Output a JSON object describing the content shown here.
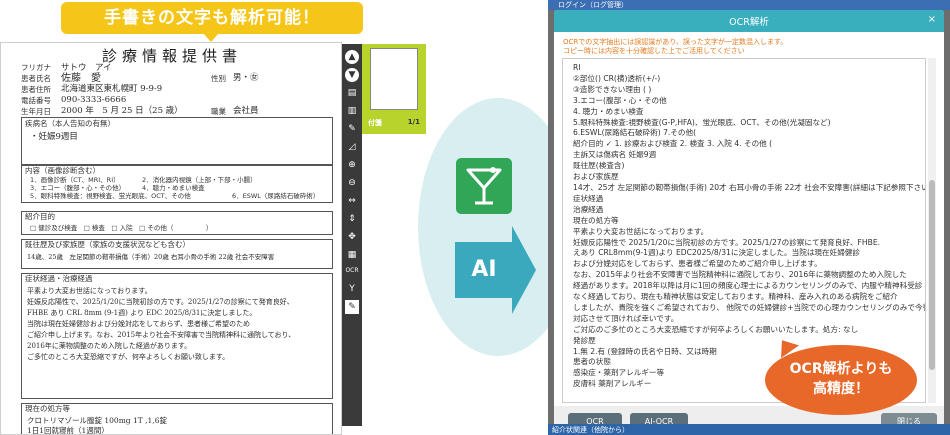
{
  "banners": {
    "left": "手書きの文字も解析可能！",
    "right_line1": "OCR解析よりも",
    "right_line2": "高精度！"
  },
  "form": {
    "title": "診療情報提供書",
    "furigana_label": "フリガナ",
    "furigana_value": "サトウ　アイ",
    "patient_name_label": "患者氏名",
    "patient_name_value": "佐藤　愛",
    "sex_label": "性別",
    "sex_value": "男・㊛",
    "address_label": "患者住所",
    "address_value": "北海道東区東札幌町 9-9-9",
    "phone_label": "電話番号",
    "phone_value": "090-3333-6666",
    "dob_label": "生年月日",
    "dob_value": "2000 年　5 月 25 日（25 歳）",
    "occupation_label": "職業",
    "occupation_value": "会社員",
    "disease_label": "疾病名（本人告知の有無）",
    "disease_value": "・妊娠9週目",
    "checkup_label": "内容（画像診断含む）",
    "checkup_1": "1．画像診断（CT、MRI、RI）",
    "checkup_2": "2．消化器内視鏡（上部・下部・小腸）",
    "checkup_3": "3．エコー（腹部・心・その他）",
    "checkup_4": "4．聴力・めまい検査",
    "checkup_5": "5．眼科特殊検査：視野検査、蛍光眼底、OCT、その他",
    "checkup_6": "6．ESWL（尿路結石破砕術）",
    "purpose_label": "紹介目的",
    "purpose_value": "□ 健診及び検査　□ 検査　□ 入院　□ その他（　　　　　）",
    "history_label": "既往歴及び家族歴（家族の支援状況なども含む）",
    "history_value": "14歳、25歳　左足関節の靭帯損傷（手術）20歳 右耳小骨の手術 22歳 社会不安障害",
    "course_label": "症状経過・治療経過",
    "course_lines": [
      "平素より大変お世話になっております。",
      "妊娠反応陽性で、2025/1/20に当院初診の方です。2025/1/27の診察にて発育良好、",
      "FHBE あり CRL 8mm (9-1週) より EDC 2025/8/31に決定しました。",
      "当院は現在妊婦健診および分娩対応をしておらず、患者様ご希望のため",
      "ご紹介申し上げます。なお、2015年より社会不安障害で当院精神科に通院しており、",
      "2016年に薬物調整のため入院した経過があります。",
      "ご多忙のところ大変恐縮ですが、何卒よろしくお願い致します。"
    ],
    "prescription_label": "現在の処方等",
    "prescription_1": "クロトリマゾール膣錠 100mg 1T ,1,6錠",
    "prescription_2": "1日1回就寝前（1週間）"
  },
  "viewer": {
    "thumb_label": "付箋",
    "page_indicator": "1/1",
    "toolbar_ocr": "OCR"
  },
  "middle": {
    "arrow_label": "AI"
  },
  "modal": {
    "bg_title": "ログイン（ログ管理）",
    "title": "OCR解析",
    "close": "×",
    "notice_1": "OCRでの文字抽出には誤認識があり、誤った文字が一定数混入します。",
    "notice_2": "コピー時には内容を十分確認した上でご活用してください",
    "lines": [
      "RI",
      "②部位() CR(横)透析(+/-)",
      "③造影できない理由 ( )",
      "3.エコー(腹部・心・その他",
      "4. 聴力・めまい検査",
      "5.眼科特殊検査:視野検査(G-P,HFA)、蛍光眼底、OCT、その他(光凝固など)",
      "6.ESWL(尿路結石破砕術) 7.その他(",
      "紹介目的 ✓ 1. 診療および検査 2. 検査 3. 入院 4. その他 (",
      "主訴又は傷病名 妊娠9週",
      "既往歴(検査含)",
      "および家族歴",
      "14才、25才 左足関節の靭帯損傷(手術) 20才 右耳小骨の手術 22才 社会不安障害(詳細は下記参照下さい)",
      "症状経過",
      "治療経過",
      "現在の処方等",
      "平素より大変お世話になっております。",
      "妊娠反応陽性で 2025/1/20に当院初診の方です。2025/1/27の診察にて発育良好、FHBE.",
      "えあり CRL8mm(9-1週)より EDC2025/8/31に決定しました。当院は現在妊婦健診",
      "および分娩対応をしておらず、患者様ご希望のためご紹介申し上げます。",
      "なお、2015年より社会不安障害で当院精神科に通院しており、2016年に薬物調整のため入院した",
      "経過があります。2018年以降は月に1回の頻度心理士によるカウンセリングのみで、内服や精神科受診",
      "なく経過しており、現在も精神状態は安定しております。精神科、産み入れのある病院をご紹介",
      "しましたが、貴院を強くご希望されており、 他院での妊婦健診+当院での心理カウンセリングのみで今後は",
      "対応させて頂ければ幸いです。",
      "ご対応のご多忙のところ大変恐縮ですが何卒よろしくお願いいたします。処方: なし",
      "発診歴",
      "1.無 2.有 (登録時の氏名や日時、又は時期",
      "患者の状態",
      "感染症・薬剤アレルギー等",
      "皮膚科 薬剤アレルギー"
    ],
    "btn_ocr": "OCR",
    "btn_aiocr": "AI-OCR",
    "btn_close": "閉じる",
    "under_text": "紹介状関連（他院から）"
  }
}
